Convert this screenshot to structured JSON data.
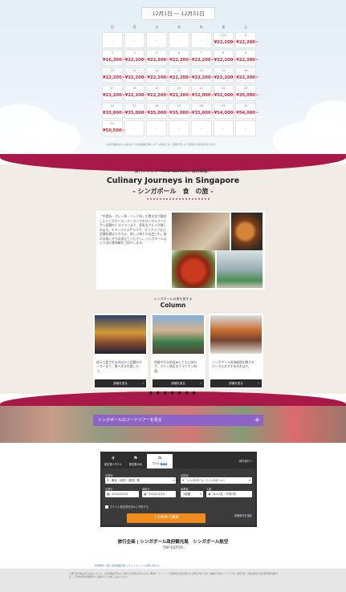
{
  "calendar": {
    "title": "12月1日 ～ 12月31日",
    "weekdays": [
      "日",
      "月",
      "火",
      "水",
      "木",
      "金",
      "土"
    ],
    "weeks": [
      [
        {
          "d": "",
          "p": "-"
        },
        {
          "d": "",
          "p": "-"
        },
        {
          "d": "",
          "p": "-"
        },
        {
          "d": "",
          "p": "-"
        },
        {
          "d": "",
          "p": "-"
        },
        {
          "d": "12/1",
          "p": "¥22,200~"
        },
        {
          "d": "2",
          "p": "¥22,200~"
        }
      ],
      [
        {
          "d": "3",
          "p": "¥16,300~"
        },
        {
          "d": "4",
          "p": "¥22,200~"
        },
        {
          "d": "5",
          "p": "¥22,200~"
        },
        {
          "d": "6",
          "p": "¥22,200~"
        },
        {
          "d": "7",
          "p": "¥22,200~"
        },
        {
          "d": "8",
          "p": "¥22,200~"
        },
        {
          "d": "9",
          "p": "¥22,200~"
        }
      ],
      [
        {
          "d": "10",
          "p": "¥22,200~"
        },
        {
          "d": "11",
          "p": "¥22,200~"
        },
        {
          "d": "12",
          "p": "¥22,200~"
        },
        {
          "d": "13",
          "p": "¥22,200~"
        },
        {
          "d": "14",
          "p": "¥22,200~"
        },
        {
          "d": "15",
          "p": "¥22,200~"
        },
        {
          "d": "16",
          "p": "¥22,200~"
        }
      ],
      [
        {
          "d": "17",
          "p": "¥22,200~"
        },
        {
          "d": "18",
          "p": "¥22,200~"
        },
        {
          "d": "19",
          "p": "¥22,200~"
        },
        {
          "d": "20",
          "p": "¥22,200~"
        },
        {
          "d": "21",
          "p": "¥32,000~"
        },
        {
          "d": "22",
          "p": "¥32,000~"
        },
        {
          "d": "23",
          "p": "¥35,000~"
        }
      ],
      [
        {
          "d": "24",
          "p": "¥35,000~"
        },
        {
          "d": "25",
          "p": "¥35,000~"
        },
        {
          "d": "26",
          "p": "¥35,000~"
        },
        {
          "d": "27",
          "p": "¥35,000~"
        },
        {
          "d": "28",
          "p": "¥35,000~"
        },
        {
          "d": "29",
          "p": "¥54,000~"
        },
        {
          "d": "30",
          "p": "¥54,000~"
        }
      ],
      [
        {
          "d": "31",
          "p": "¥50,500~"
        },
        {
          "d": "",
          "p": "-"
        },
        {
          "d": "",
          "p": "-"
        },
        {
          "d": "",
          "p": "-"
        },
        {
          "d": "",
          "p": "-"
        },
        {
          "d": "",
          "p": "-"
        },
        {
          "d": "",
          "p": "-"
        }
      ]
    ],
    "note": "※表示価格は大人1名あたりの往復航空券＋ホテル料金です。空席状況により変動する場合があります。"
  },
  "culinary": {
    "eyebrow": "旅行メディア「TRIP EDITOR」独占掲載！",
    "title": "Culinary Journeys in Singapore",
    "subtitle": "- シンガポール　食　の旅 -",
    "intro": "「中国系・マレー系・インド系」の食文化が融合したシンガポール。ホーカーでのローカルフードから話題のレストランまで、多彩なグルメが楽しめます。チキンライスやラクサ、チリクラブなど定番料理はもちろん、新しい味との出会いも。旅の計画にぜひお役立てください。シンガポールならではの食体験をご紹介します。"
  },
  "column": {
    "eyebrow": "シンガポールの食を旅する",
    "title": "Column",
    "cards": [
      {
        "text": "地元で愛される名店から話題のホーカーまで、食べ歩きを楽しもう。",
        "button": "詳細を見る"
      },
      {
        "text": "色鮮やかな街並みとともに味わう、カトン地区のプラナカン料理。",
        "button": "詳細を見る"
      },
      {
        "text": "シンガポール名物料理の数々を、ローカルおすすめのお店で。",
        "button": "詳細を見る"
      }
    ],
    "pager": "● ● ● ● ● ● ●"
  },
  "tour_button": {
    "label": "シンガポールのフードツアーを見る",
    "icon": "+"
  },
  "widget": {
    "tabs": [
      {
        "icon": "✈",
        "label": "航空券+ホテル"
      },
      {
        "icon": "⚑",
        "label": "航空券のみ"
      },
      {
        "icon": "⌂",
        "label": "ホテル",
        "badge": "NEW"
      }
    ],
    "link": "海外旅行へ",
    "from_label": "出発地",
    "from_value": "東京（羽田・成田）発",
    "to_label": "目的地",
    "to_value": "シンガポール（シンガポール）",
    "depart_label": "出発日",
    "depart_value": "2024/12/10",
    "return_label": "帰着日",
    "return_value": "2024/12/15",
    "rooms_label": "部屋数",
    "rooms_value": "1部屋",
    "guests_label": "人数",
    "guests_value": "大人2名・子供0名",
    "checkbox_label": "ホテルと航空券を別々に予約する",
    "detail_link": "詳細条件を指定",
    "search_button": "この条件で検索"
  },
  "operator": {
    "line1": "旅行企画 | シンガポール政府観光局　シンガポール航空",
    "line2": "TRIP EDITOR"
  },
  "links": "利用規約 | 個人情報保護方針 | サイトマップ | お問い合わせ",
  "footer_text": "ご旅行条件書は必ずお読みください。表示価格は予告なく変更となる場合があります。燃油サーチャージ・空港税等は別途必要となる場合があります。掲載の写真はイメージです。旅行企画・実施は観光庁長官登録旅行業者です。ご予約の際は各種条件をご確認のうえお申し込みください。"
}
